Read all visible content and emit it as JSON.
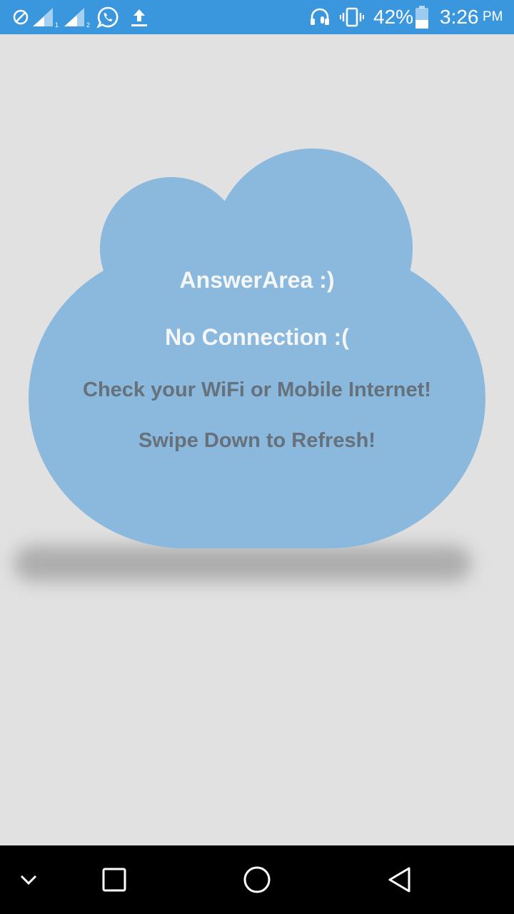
{
  "status_bar": {
    "battery_percent": "42%",
    "time": "3:26",
    "ampm": "PM",
    "background_color": "#3a97de",
    "icons": [
      "do-not-disturb-icon",
      "signal-sim1-icon",
      "signal-sim2-icon",
      "whatsapp-icon",
      "upload-icon",
      "headset-mic-icon",
      "vibrate-icon",
      "battery-icon"
    ]
  },
  "main": {
    "title": "AnswerArea :)",
    "subtitle": "No Connection :(",
    "hint_line_1": "Check your WiFi or Mobile Internet!",
    "hint_line_2": "Swipe Down to Refresh!",
    "cloud_color": "#8ab9dd",
    "background_color": "#e1e1e1"
  },
  "nav_bar": {
    "icons": [
      "chevron-down-icon",
      "recent-apps-icon",
      "home-icon",
      "back-icon"
    ]
  }
}
